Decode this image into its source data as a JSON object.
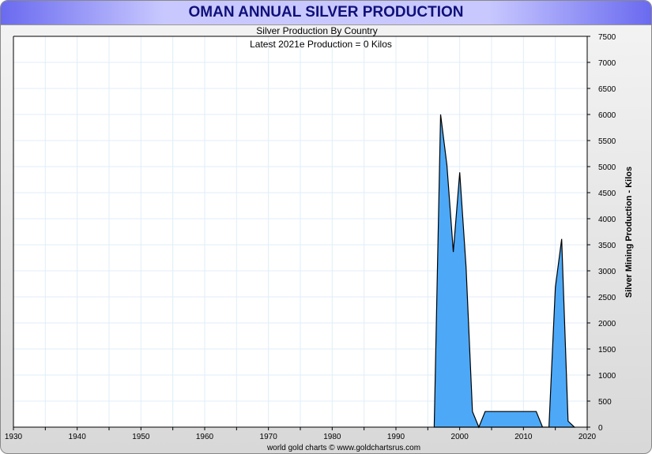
{
  "chart_data": {
    "type": "area",
    "title": "OMAN ANNUAL SILVER PRODUCTION",
    "subtitle": "Silver Production By Country",
    "annotation": "Latest 2021e Production = 0 Kilos",
    "ylabel": "Silver Mining Production - Kilos",
    "footer": "world gold charts © www.goldchartsrus.com",
    "xlim": [
      1930,
      2020
    ],
    "ylim": [
      0,
      7500
    ],
    "x_ticks": [
      1930,
      1940,
      1950,
      1960,
      1970,
      1980,
      1990,
      2000,
      2010,
      2020
    ],
    "y_ticks": [
      0,
      500,
      1000,
      1500,
      2000,
      2500,
      3000,
      3500,
      4000,
      4500,
      5000,
      5500,
      6000,
      6500,
      7000,
      7500
    ],
    "grid": true,
    "fill_color": "#4da9f7",
    "series": [
      {
        "name": "Oman",
        "x": [
          1996,
          1997,
          1998,
          1999,
          2000,
          2001,
          2002,
          2003,
          2004,
          2005,
          2006,
          2007,
          2008,
          2009,
          2010,
          2011,
          2012,
          2013,
          2014,
          2015,
          2016,
          2017,
          2018
        ],
        "values": [
          0,
          6000,
          5030,
          3360,
          4890,
          3080,
          300,
          0,
          300,
          300,
          300,
          300,
          300,
          300,
          300,
          300,
          300,
          0,
          0,
          2680,
          3610,
          115,
          0
        ]
      }
    ]
  }
}
